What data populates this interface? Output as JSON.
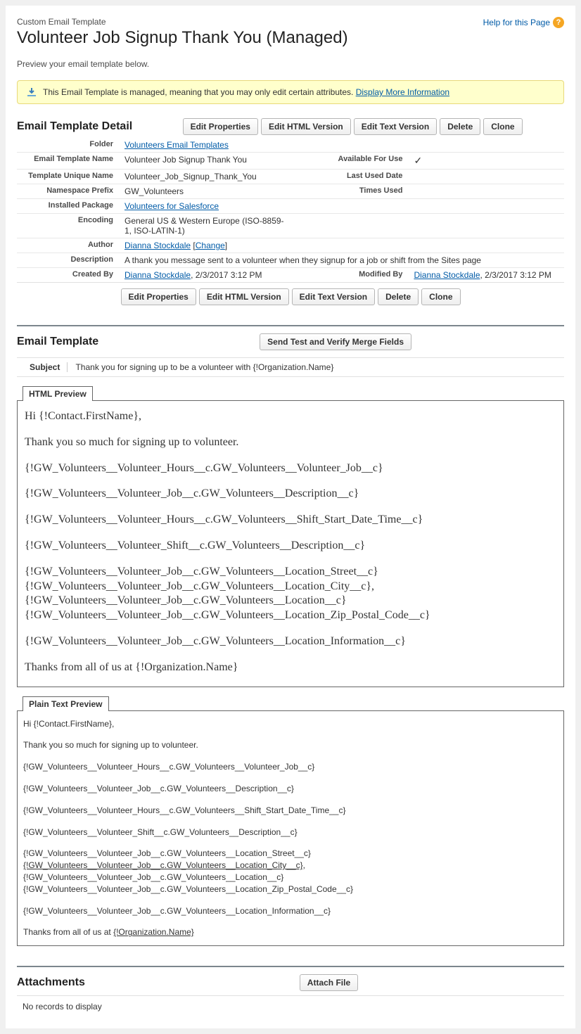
{
  "header": {
    "page_type": "Custom Email Template",
    "title": "Volunteer Job Signup Thank You (Managed)",
    "help_label": "Help for this Page",
    "preview_text": "Preview your email template below."
  },
  "info_box": {
    "text": "This Email Template is managed, meaning that you may only edit certain attributes.",
    "link_text": "Display More Information"
  },
  "detail": {
    "section_title": "Email Template Detail",
    "buttons": {
      "edit_properties": "Edit Properties",
      "edit_html": "Edit HTML Version",
      "edit_text": "Edit Text Version",
      "delete": "Delete",
      "clone": "Clone"
    },
    "labels": {
      "folder": "Folder",
      "name": "Email Template Name",
      "unique_name": "Template Unique Name",
      "namespace": "Namespace Prefix",
      "package": "Installed Package",
      "encoding": "Encoding",
      "author": "Author",
      "description": "Description",
      "created_by": "Created By",
      "available": "Available For Use",
      "last_used": "Last Used Date",
      "times_used": "Times Used",
      "modified_by": "Modified By"
    },
    "values": {
      "folder": "Volunteers Email Templates",
      "name": "Volunteer Job Signup Thank You",
      "unique_name": "Volunteer_Job_Signup_Thank_You",
      "namespace": "GW_Volunteers",
      "package": "Volunteers for Salesforce",
      "encoding": "General US & Western Europe (ISO-8859-1, ISO-LATIN-1)",
      "author": "Dianna Stockdale",
      "author_change": "Change",
      "description": "A thank you message sent to a volunteer when they signup for a job or shift from the Sites page",
      "created_by": "Dianna Stockdale",
      "created_date": ", 2/3/2017 3:12 PM",
      "modified_by": "Dianna Stockdale",
      "modified_date": ", 2/3/2017 3:12 PM",
      "available": "✓",
      "last_used": "",
      "times_used": ""
    }
  },
  "template": {
    "section_title": "Email Template",
    "send_test_btn": "Send Test and Verify Merge Fields",
    "subject_label": "Subject",
    "subject_value": "Thank you for signing up to be a volunteer with {!Organization.Name}",
    "html_preview_label": "HTML Preview",
    "plain_preview_label": "Plain Text Preview",
    "html_body": {
      "greeting": "Hi {!Contact.FirstName},",
      "thanks": "Thank you so much for signing up to volunteer.",
      "m1": "{!GW_Volunteers__Volunteer_Hours__c.GW_Volunteers__Volunteer_Job__c}",
      "m2": "{!GW_Volunteers__Volunteer_Job__c.GW_Volunteers__Description__c}",
      "m3": "{!GW_Volunteers__Volunteer_Hours__c.GW_Volunteers__Shift_Start_Date_Time__c}",
      "m4": "{!GW_Volunteers__Volunteer_Shift__c.GW_Volunteers__Description__c}",
      "loc1": "{!GW_Volunteers__Volunteer_Job__c.GW_Volunteers__Location_Street__c}",
      "loc2": "{!GW_Volunteers__Volunteer_Job__c.GW_Volunteers__Location_City__c},",
      "loc3": "{!GW_Volunteers__Volunteer_Job__c.GW_Volunteers__Location__c}",
      "loc4": "{!GW_Volunteers__Volunteer_Job__c.GW_Volunteers__Location_Zip_Postal_Code__c}",
      "loc_info": "{!GW_Volunteers__Volunteer_Job__c.GW_Volunteers__Location_Information__c}",
      "closing": "Thanks from all of us at {!Organization.Name}"
    },
    "plain_body": {
      "greeting": "Hi {!Contact.FirstName},",
      "thanks": "Thank you so much for signing up to volunteer.",
      "m1": "{!GW_Volunteers__Volunteer_Hours__c.GW_Volunteers__Volunteer_Job__c}",
      "m2": "{!GW_Volunteers__Volunteer_Job__c.GW_Volunteers__Description__c}",
      "m3": "{!GW_Volunteers__Volunteer_Hours__c.GW_Volunteers__Shift_Start_Date_Time__c}",
      "m4": "{!GW_Volunteers__Volunteer_Shift__c.GW_Volunteers__Description__c}",
      "loc1": "{!GW_Volunteers__Volunteer_Job__c.GW_Volunteers__Location_Street__c}",
      "loc2_a": "{!GW_Volunteers__Volunteer_Job__c.GW_Volunteers__Location_City__c}",
      "loc2_b": ",",
      "loc3": "{!GW_Volunteers__Volunteer_Job__c.GW_Volunteers__Location__c}",
      "loc4": "{!GW_Volunteers__Volunteer_Job__c.GW_Volunteers__Location_Zip_Postal_Code__c}",
      "loc_info": "{!GW_Volunteers__Volunteer_Job__c.GW_Volunteers__Location_Information__c}",
      "closing_a": "Thanks from all of us at ",
      "closing_b": "{!Organization.Name}"
    }
  },
  "attachments": {
    "section_title": "Attachments",
    "attach_btn": "Attach File",
    "empty_text": "No records to display"
  }
}
